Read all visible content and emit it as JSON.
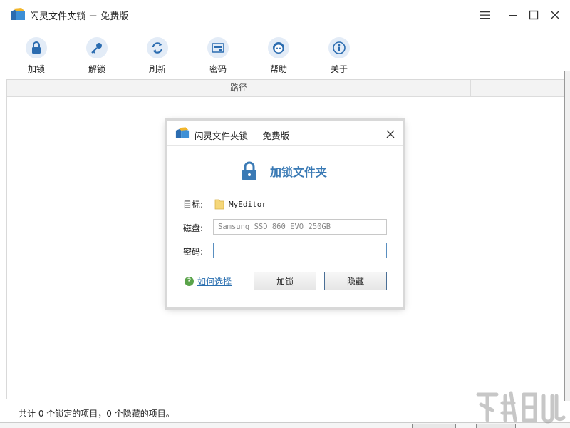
{
  "app": {
    "title": "闪灵文件夹锁 － 免费版"
  },
  "toolbar": {
    "items": [
      {
        "label": "加锁",
        "icon": "lock-icon"
      },
      {
        "label": "解锁",
        "icon": "key-icon"
      },
      {
        "label": "刷新",
        "icon": "refresh-icon"
      },
      {
        "label": "密码",
        "icon": "password-icon"
      },
      {
        "label": "帮助",
        "icon": "help-face-icon"
      },
      {
        "label": "关于",
        "icon": "info-icon"
      }
    ]
  },
  "list": {
    "columns": [
      "路径",
      ""
    ]
  },
  "status": {
    "text": "共计 0 个锁定的项目，0 个隐藏的项目。"
  },
  "dialog": {
    "title": "闪灵文件夹锁 － 免费版",
    "heading": "加锁文件夹",
    "target_label": "目标:",
    "target_value": "MyEditor",
    "disk_label": "磁盘:",
    "disk_value": "Samsung SSD 860 EVO 250GB",
    "password_label": "密码:",
    "password_value": "",
    "help_text": "如何选择",
    "lock_button": "加锁",
    "hide_button": "隐藏"
  },
  "colors": {
    "accent": "#3a7ab5",
    "icon_bg": "#e3ecf7",
    "link": "#2a6fb0",
    "help_green": "#5aa34a"
  }
}
